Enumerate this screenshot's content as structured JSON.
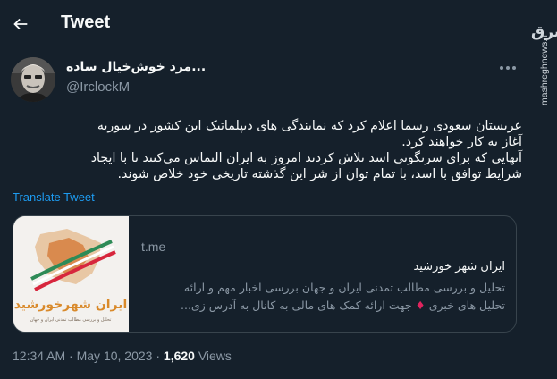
{
  "header": {
    "title": "Tweet"
  },
  "author": {
    "name": "مرد خوش‌خیال ساده...",
    "handle": "@IrclockM"
  },
  "tweet": {
    "lines": [
      "عربستان سعودی رسما اعلام کرد که نمایندگی های دیپلماتیک این کشور در سوریه",
      "آغاز به کار خواهند کرد.",
      "آنهایی که برای سرنگونی اسد تلاش کردند امروز به ایران التماس می‌کنند تا با ایجاد",
      "شرایط توافق با اسد، با تمام توان از شر این گذشته تاریخی خود خلاص شوند."
    ],
    "translate_label": "Translate Tweet"
  },
  "card": {
    "domain": "t.me",
    "title": "ایران شهر خورشید",
    "desc_line1": "تحلیل و بررسی مطالب تمدنی ایران و جهان بررسی اخبار مهم و ارائه",
    "desc_line2_before": "تحلیل های خبری",
    "desc_line2_after": "جهت ارائه کمک های مالی به کانال به آدرس زی...",
    "thumb_title": "ایران شهرخورشید",
    "thumb_subtitle": "تحلیل و بررسی مطالب تمدنی ایران و جهان"
  },
  "meta": {
    "time": "12:34 AM",
    "sep": " · ",
    "date": "May 10, 2023",
    "views_count": "1,620",
    "views_label": " Views"
  },
  "watermark": {
    "logo_text": "مشرق",
    "url": "mashreghnews.ir"
  },
  "colors": {
    "background": "#15202b",
    "accent": "#1d9bf0",
    "muted": "#8b98a5",
    "border": "#38444d"
  },
  "icons": {
    "back": "arrow-left-icon",
    "more": "more-horizontal-icon",
    "diamond": "red-diamond-icon"
  }
}
